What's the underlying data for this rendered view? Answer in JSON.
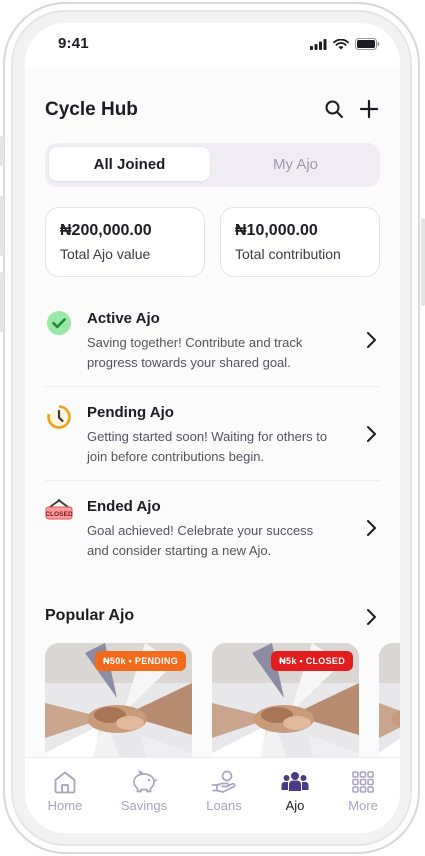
{
  "status_bar": {
    "time": "9:41"
  },
  "header": {
    "title": "Cycle Hub",
    "search_icon": "search-icon",
    "add_icon": "plus-icon"
  },
  "segment": {
    "tabs": [
      {
        "label": "All Joined",
        "active": true
      },
      {
        "label": "My Ajo",
        "active": false
      }
    ]
  },
  "stats": [
    {
      "value": "₦200,000.00",
      "label": "Total Ajo value"
    },
    {
      "value": "₦10,000.00",
      "label": "Total contribution"
    }
  ],
  "menu": [
    {
      "title": "Active Ajo",
      "description": "Saving together! Contribute and track progress towards your shared goal.",
      "icon": "check-circle-icon"
    },
    {
      "title": "Pending Ajo",
      "description": "Getting started soon! Waiting for others to join before contributions begin.",
      "icon": "timer-icon"
    },
    {
      "title": "Ended Ajo",
      "description": "Goal achieved! Celebrate your success and consider starting a new Ajo.",
      "icon": "closed-sign-icon",
      "icon_text": "CLOSED"
    }
  ],
  "popular": {
    "title": "Popular Ajo",
    "cards": [
      {
        "badge": "₦50k • PENDING",
        "badge_color": "#f26a1b"
      },
      {
        "badge": "₦5k • CLOSED",
        "badge_color": "#e11d1d"
      }
    ]
  },
  "tabbar": [
    {
      "label": "Home",
      "icon": "home-icon",
      "active": false
    },
    {
      "label": "Savings",
      "icon": "piggy-bank-icon",
      "active": false
    },
    {
      "label": "Loans",
      "icon": "hand-coin-icon",
      "active": false
    },
    {
      "label": "Ajo",
      "icon": "group-icon",
      "active": true
    },
    {
      "label": "More",
      "icon": "grid-icon",
      "active": false
    }
  ],
  "colors": {
    "accent": "#4b3a86",
    "inactive_icon": "#aaa3c2",
    "success": "#3fbf5a",
    "pending": "#f0a21f"
  }
}
